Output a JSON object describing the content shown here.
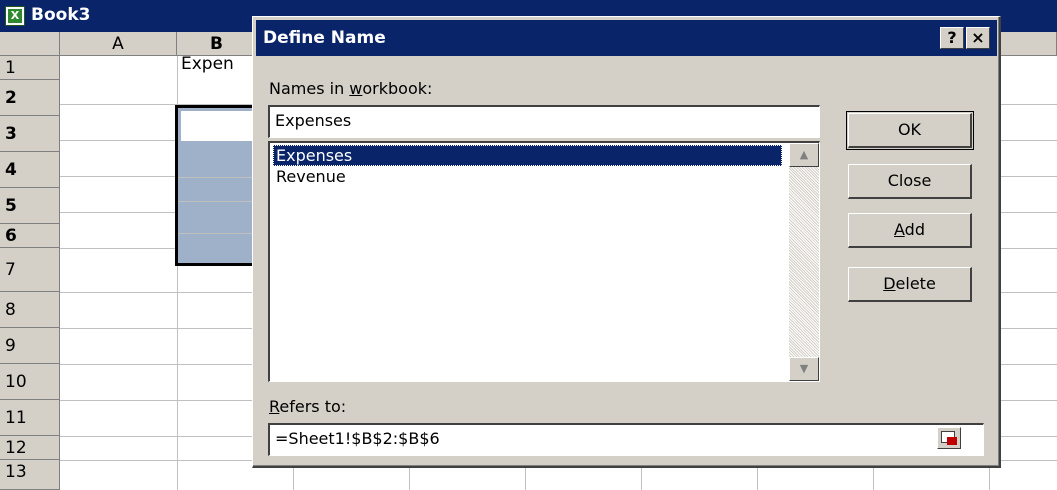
{
  "window": {
    "title": "Book3",
    "icon": "excel-icon"
  },
  "sheet": {
    "columns": [
      "A",
      "B"
    ],
    "rows": [
      "1",
      "2",
      "3",
      "4",
      "5",
      "6",
      "7",
      "8",
      "9",
      "10",
      "11",
      "12",
      "13"
    ],
    "cells": {
      "B1": "Expen"
    }
  },
  "dialog": {
    "title": "Define Name",
    "help_label": "?",
    "close_label": "×",
    "names_label_pre": "Names in ",
    "names_label_acc": "w",
    "names_label_post": "orkbook:",
    "name_value": "Expenses",
    "names": [
      "Expenses",
      "Revenue"
    ],
    "selected_name": "Expenses",
    "refers_label_acc": "R",
    "refers_label_post": "efers to:",
    "refers_value": "=Sheet1!$B$2:$B$6",
    "buttons": {
      "ok": "OK",
      "close": "Close",
      "add_acc": "A",
      "add_rest": "dd",
      "delete_acc": "D",
      "delete_rest": "elete"
    },
    "scroll_up": "▲",
    "scroll_down": "▼"
  },
  "colors": {
    "title_bar": "#0a246a",
    "face": "#d4d0c8",
    "selection_fill": "#9fb0c9"
  }
}
